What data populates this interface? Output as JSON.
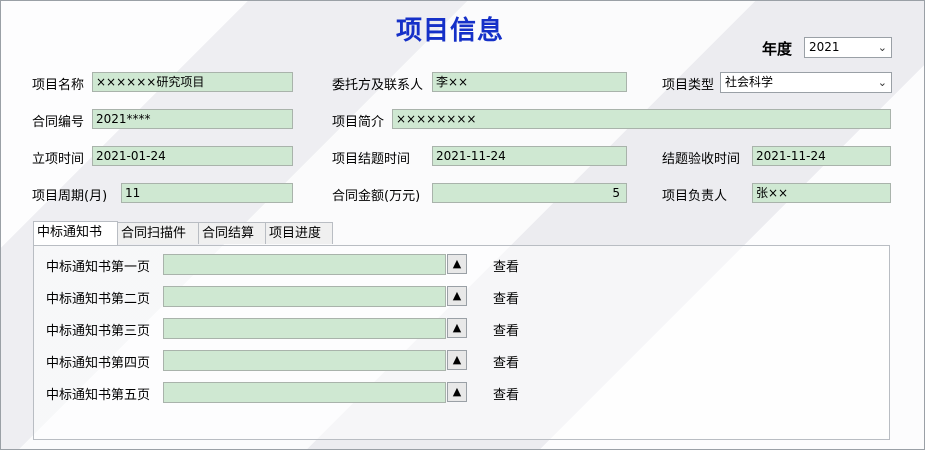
{
  "title": "项目信息",
  "year": {
    "label": "年度",
    "value": "2021"
  },
  "fields": {
    "project_name": {
      "label": "项目名称",
      "value": "××××××研究项目"
    },
    "client": {
      "label": "委托方及联系人",
      "value": "李××"
    },
    "project_type": {
      "label": "项目类型",
      "value": "社会科学"
    },
    "contract_no": {
      "label": "合同编号",
      "value": "2021****"
    },
    "summary": {
      "label": "项目简介",
      "value": "××××××××"
    },
    "start_date": {
      "label": "立项时间",
      "value": "2021-01-24"
    },
    "end_date": {
      "label": "项目结题时间",
      "value": "2021-11-24"
    },
    "accept_date": {
      "label": "结题验收时间",
      "value": "2021-11-24"
    },
    "period": {
      "label": "项目周期(月)",
      "value": "11"
    },
    "amount": {
      "label": "合同金额(万元)",
      "value": "5"
    },
    "manager": {
      "label": "项目负责人",
      "value": "张××"
    }
  },
  "tabs": [
    "中标通知书",
    "合同扫描件",
    "合同结算",
    "项目进度"
  ],
  "uploads": {
    "up_symbol": "▲",
    "view_label": "查看",
    "rows": [
      "中标通知书第一页",
      "中标通知书第二页",
      "中标通知书第三页",
      "中标通知书第四页",
      "中标通知书第五页"
    ]
  }
}
